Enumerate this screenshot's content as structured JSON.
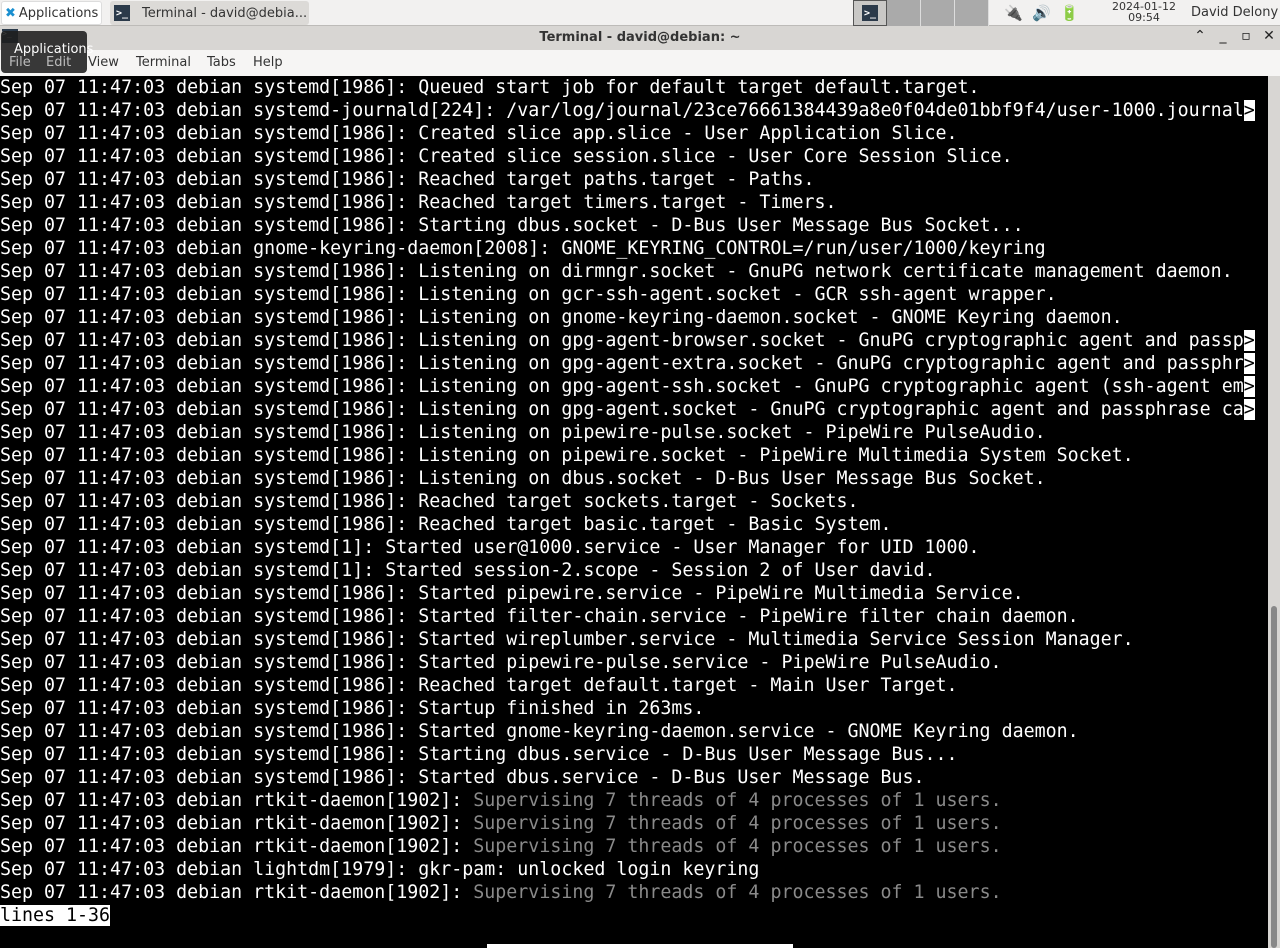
{
  "panel": {
    "applications": "Applications",
    "task": "Terminal - david@debia...",
    "date": "2024-01-12",
    "time": "09:54",
    "user": "David Delony"
  },
  "window": {
    "title": "Terminal - david@debian: ~",
    "tooltip": "Applications"
  },
  "menu": [
    "File",
    "Edit",
    "View",
    "Terminal",
    "Tabs",
    "Help"
  ],
  "lines": [
    {
      "t": "Sep 07 11:47:03 debian systemd[1986]: Queued start job for default target default.target."
    },
    {
      "t": "Sep 07 11:47:03 debian systemd-journald[224]: /var/log/journal/23ce76661384439a8e0f04de01bbf9f4/user-1000.journal",
      "trunc": ">"
    },
    {
      "t": "Sep 07 11:47:03 debian systemd[1986]: Created slice app.slice - User Application Slice."
    },
    {
      "t": "Sep 07 11:47:03 debian systemd[1986]: Created slice session.slice - User Core Session Slice."
    },
    {
      "t": "Sep 07 11:47:03 debian systemd[1986]: Reached target paths.target - Paths."
    },
    {
      "t": "Sep 07 11:47:03 debian systemd[1986]: Reached target timers.target - Timers."
    },
    {
      "t": "Sep 07 11:47:03 debian systemd[1986]: Starting dbus.socket - D-Bus User Message Bus Socket..."
    },
    {
      "t": "Sep 07 11:47:03 debian gnome-keyring-daemon[2008]: GNOME_KEYRING_CONTROL=/run/user/1000/keyring"
    },
    {
      "t": "Sep 07 11:47:03 debian systemd[1986]: Listening on dirmngr.socket - GnuPG network certificate management daemon."
    },
    {
      "t": "Sep 07 11:47:03 debian systemd[1986]: Listening on gcr-ssh-agent.socket - GCR ssh-agent wrapper."
    },
    {
      "t": "Sep 07 11:47:03 debian systemd[1986]: Listening on gnome-keyring-daemon.socket - GNOME Keyring daemon."
    },
    {
      "t": "Sep 07 11:47:03 debian systemd[1986]: Listening on gpg-agent-browser.socket - GnuPG cryptographic agent and passp",
      "trunc": ">"
    },
    {
      "t": "Sep 07 11:47:03 debian systemd[1986]: Listening on gpg-agent-extra.socket - GnuPG cryptographic agent and passphr",
      "trunc": ">"
    },
    {
      "t": "Sep 07 11:47:03 debian systemd[1986]: Listening on gpg-agent-ssh.socket - GnuPG cryptographic agent (ssh-agent em",
      "trunc": ">"
    },
    {
      "t": "Sep 07 11:47:03 debian systemd[1986]: Listening on gpg-agent.socket - GnuPG cryptographic agent and passphrase ca",
      "trunc": ">"
    },
    {
      "t": "Sep 07 11:47:03 debian systemd[1986]: Listening on pipewire-pulse.socket - PipeWire PulseAudio."
    },
    {
      "t": "Sep 07 11:47:03 debian systemd[1986]: Listening on pipewire.socket - PipeWire Multimedia System Socket."
    },
    {
      "t": "Sep 07 11:47:03 debian systemd[1986]: Listening on dbus.socket - D-Bus User Message Bus Socket."
    },
    {
      "t": "Sep 07 11:47:03 debian systemd[1986]: Reached target sockets.target - Sockets."
    },
    {
      "t": "Sep 07 11:47:03 debian systemd[1986]: Reached target basic.target - Basic System."
    },
    {
      "t": "Sep 07 11:47:03 debian systemd[1]: Started user@1000.service - User Manager for UID 1000."
    },
    {
      "t": "Sep 07 11:47:03 debian systemd[1]: Started session-2.scope - Session 2 of User david."
    },
    {
      "t": "Sep 07 11:47:03 debian systemd[1986]: Started pipewire.service - PipeWire Multimedia Service."
    },
    {
      "t": "Sep 07 11:47:03 debian systemd[1986]: Started filter-chain.service - PipeWire filter chain daemon."
    },
    {
      "t": "Sep 07 11:47:03 debian systemd[1986]: Started wireplumber.service - Multimedia Service Session Manager."
    },
    {
      "t": "Sep 07 11:47:03 debian systemd[1986]: Started pipewire-pulse.service - PipeWire PulseAudio."
    },
    {
      "t": "Sep 07 11:47:03 debian systemd[1986]: Reached target default.target - Main User Target."
    },
    {
      "t": "Sep 07 11:47:03 debian systemd[1986]: Startup finished in 263ms."
    },
    {
      "t": "Sep 07 11:47:03 debian systemd[1986]: Started gnome-keyring-daemon.service - GNOME Keyring daemon."
    },
    {
      "t": "Sep 07 11:47:03 debian systemd[1986]: Starting dbus.service - D-Bus User Message Bus..."
    },
    {
      "t": "Sep 07 11:47:03 debian systemd[1986]: Started dbus.service - D-Bus User Message Bus."
    },
    {
      "t": "Sep 07 11:47:03 debian rtkit-daemon[1902]: ",
      "dim": "Supervising 7 threads of 4 processes of 1 users."
    },
    {
      "t": "Sep 07 11:47:03 debian rtkit-daemon[1902]: ",
      "dim": "Supervising 7 threads of 4 processes of 1 users."
    },
    {
      "t": "Sep 07 11:47:03 debian rtkit-daemon[1902]: ",
      "dim": "Supervising 7 threads of 4 processes of 1 users."
    },
    {
      "t": "Sep 07 11:47:03 debian lightdm[1979]: gkr-pam: unlocked login keyring"
    },
    {
      "t": "Sep 07 11:47:03 debian rtkit-daemon[1902]: ",
      "dim": "Supervising 7 threads of 4 processes of 1 users."
    }
  ],
  "status": "lines 1-36",
  "scroll_position": "bottom"
}
